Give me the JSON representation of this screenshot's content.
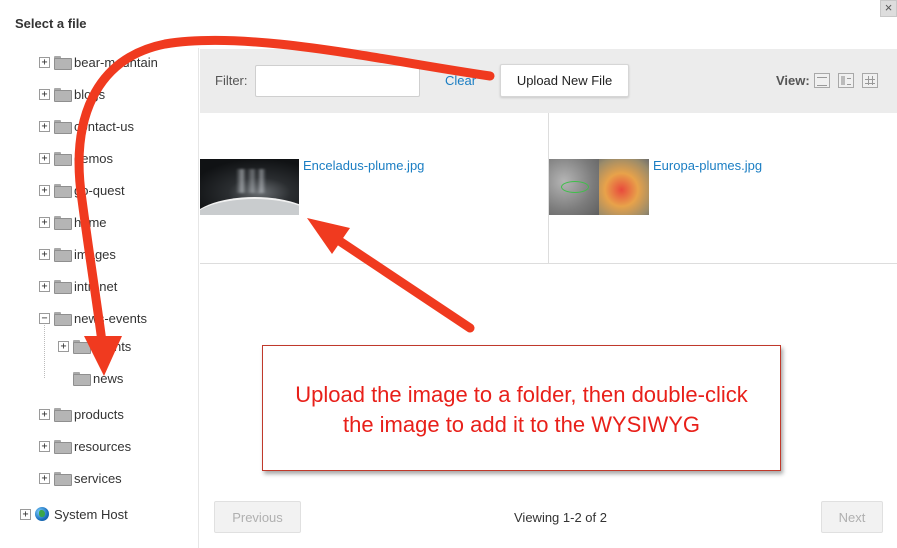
{
  "dialog": {
    "title": "Select a file",
    "close_label": "×"
  },
  "tree": {
    "items": [
      {
        "label": "bear-mountain"
      },
      {
        "label": "blogs"
      },
      {
        "label": "contact-us"
      },
      {
        "label": "demos"
      },
      {
        "label": "go-quest"
      },
      {
        "label": "home"
      },
      {
        "label": "images"
      },
      {
        "label": "intranet"
      },
      {
        "label": "news-events"
      },
      {
        "label": "events"
      },
      {
        "label": "news"
      },
      {
        "label": "products"
      },
      {
        "label": "resources"
      },
      {
        "label": "services"
      }
    ],
    "host": {
      "label": "System Host"
    },
    "expand_symbol": "+",
    "collapse_symbol": "−"
  },
  "toolbar": {
    "filter_label": "Filter:",
    "filter_value": "",
    "filter_placeholder": "",
    "clear_label": "Clear",
    "upload_label": "Upload New File",
    "view_label": "View:"
  },
  "files": [
    {
      "name": "Enceladus-plume.jpg"
    },
    {
      "name": "Europa-plumes.jpg"
    }
  ],
  "annotation": {
    "text": "Upload the image to a folder, then double-click the image to add it to the WYSIWYG"
  },
  "pager": {
    "previous_label": "Previous",
    "status": "Viewing 1-2 of 2",
    "next_label": "Next"
  },
  "colors": {
    "link": "#1b7ec3",
    "annotation": "#e8201a",
    "arrow": "#f03a1f"
  }
}
